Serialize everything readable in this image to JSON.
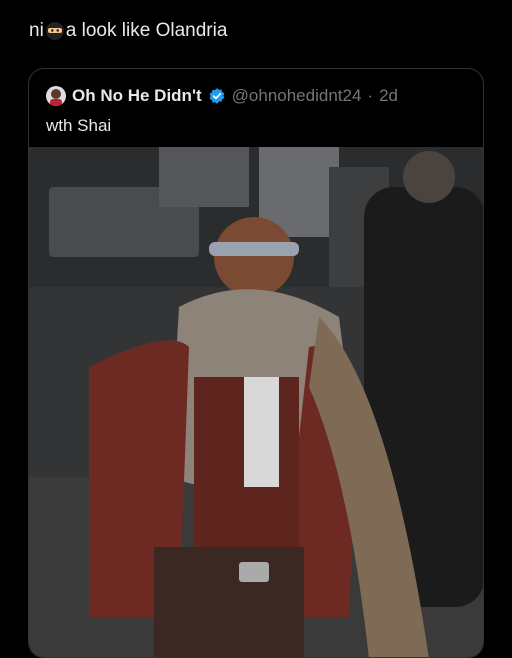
{
  "post": {
    "text_before": "ni",
    "text_after": "a look like Olandria",
    "emoji_icon": "ninja-emoji-icon"
  },
  "quoted_post": {
    "display_name": "Oh No He Didn't",
    "verified_icon": "verified-badge-icon",
    "handle": "@ohnohedidnt24",
    "separator": "·",
    "age": "2d",
    "text": "wth Shai",
    "media_icon": "photo-of-man-in-fur-scarf-and-leather-jacket"
  },
  "colors": {
    "background": "#000000",
    "text_primary": "#e7e9ea",
    "text_secondary": "#71767b",
    "card_border": "#2f3336",
    "verified_blue": "#1d9bf0"
  }
}
